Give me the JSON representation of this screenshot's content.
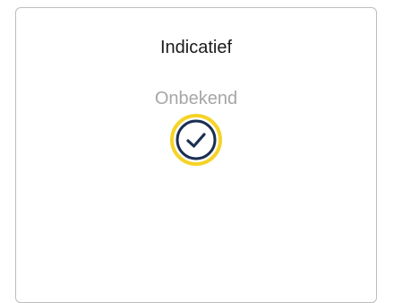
{
  "card": {
    "title": "Indicatief",
    "status": "Onbekend"
  },
  "icons": {
    "status_icon": "check-circle-icon"
  },
  "colors": {
    "title_text": "#1a1a1a",
    "status_text": "#a6a6a6",
    "card_border": "#bdbdbd",
    "icon_navy": "#1b2f52",
    "icon_highlight": "#f5d327"
  }
}
